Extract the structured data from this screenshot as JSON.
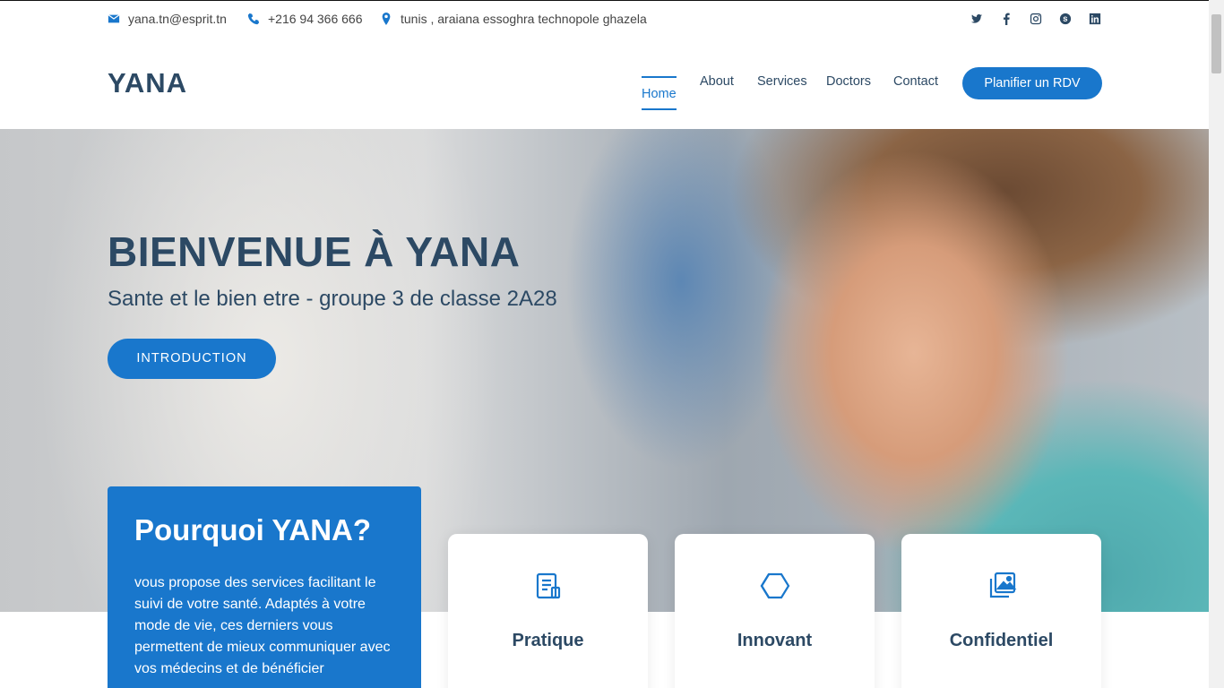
{
  "topbar": {
    "email": "yana.tn@esprit.tn",
    "phone": "+216 94 366 666",
    "address": "tunis , araiana essoghra technopole ghazela",
    "social": [
      "twitter-icon",
      "facebook-icon",
      "instagram-icon",
      "skype-icon",
      "linkedin-icon"
    ]
  },
  "header": {
    "logo": "YANA",
    "nav": [
      "Home",
      "About",
      "Services",
      "Doctors",
      "Contact"
    ],
    "cta": "Planifier un RDV"
  },
  "hero": {
    "title": "BIENVENUE À YANA",
    "subtitle": "Sante et le bien etre - groupe 3 de classe 2A28",
    "button": "INTRODUCTION"
  },
  "why": {
    "title": "Pourquoi YANA?",
    "text": "vous propose des services facilitant le suivi de votre santé. Adaptés à votre mode de vie, ces derniers vous permettent de mieux communiquer avec vos médecins et de bénéficier"
  },
  "features": [
    {
      "icon": "document-icon",
      "title": "Pratique"
    },
    {
      "icon": "cube-icon",
      "title": "Innovant"
    },
    {
      "icon": "images-icon",
      "title": "Confidentiel"
    }
  ],
  "colors": {
    "accent": "#1977cc",
    "heading": "#2c4964"
  }
}
